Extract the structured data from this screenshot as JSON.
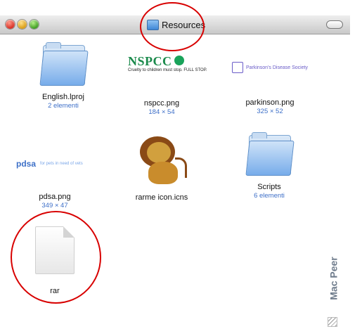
{
  "window": {
    "title": "Resources"
  },
  "items": [
    {
      "name": "English.lproj",
      "sub": "2 elementi",
      "kind": "folder"
    },
    {
      "name": "nspcc.png",
      "sub": "184 × 54",
      "kind": "image",
      "thumb_text": "NSPCC",
      "thumb_tagline": "Cruelty to children must stop. FULL STOP."
    },
    {
      "name": "parkinson.png",
      "sub": "325 × 52",
      "kind": "image",
      "thumb_text": "Parkinson's Disease Society"
    },
    {
      "name": "pdsa.png",
      "sub": "349 × 47",
      "kind": "image",
      "thumb_logo": "pdsa",
      "thumb_tagline": "for pets in need of vets"
    },
    {
      "name": "rarme icon.icns",
      "sub": "",
      "kind": "icon"
    },
    {
      "name": "Scripts",
      "sub": "6 elementi",
      "kind": "folder"
    },
    {
      "name": "rar",
      "sub": "",
      "kind": "document"
    }
  ],
  "watermark": "Mac Peer",
  "colors": {
    "highlight_circle": "#d80000",
    "subtext": "#3d6fc8"
  }
}
